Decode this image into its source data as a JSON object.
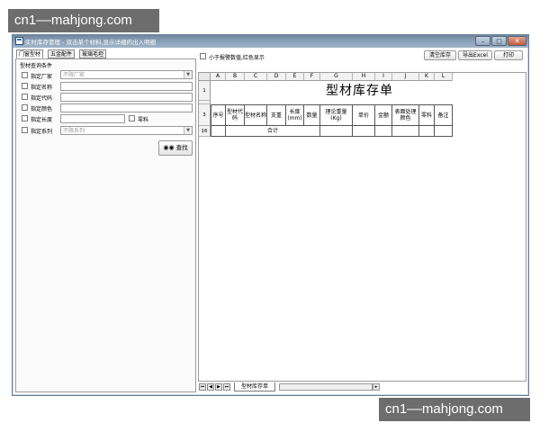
{
  "watermark_top": "cn1––mahjong.com",
  "watermark_bottom": "cn1––mahjong.com",
  "window": {
    "title": "实时库存管理 - 双击某个材料,显示详细的出入明细",
    "min_glyph": "–",
    "max_glyph": "□",
    "close_glyph": "✕"
  },
  "tabs": [
    "门窗型材",
    "五金配件",
    "玻璃毛坦"
  ],
  "query": {
    "group_label": "型材查询条件",
    "manufacturer_label": "指定厂家",
    "manufacturer_placeholder": "不限厂家",
    "name_label": "指定名称",
    "code_label": "指定代码",
    "color_label": "指定颜色",
    "length_label": "指定长度",
    "scrap_label": "零料",
    "series_label": "指定系列",
    "series_placeholder": "不限系列",
    "search_button": "查找"
  },
  "toolbar": {
    "alarm_label": "小于报警数值,红色显示",
    "clear_button": "清空库存",
    "export_button": "导出Excel",
    "print_button": "打印"
  },
  "sheet": {
    "columns": [
      "A",
      "B",
      "C",
      "D",
      "E",
      "F",
      "G",
      "H",
      "I",
      "J",
      "K",
      "L"
    ],
    "row_numbers": [
      "1",
      "2",
      "3",
      "16"
    ],
    "title": "型材库存单",
    "headers": [
      "序号",
      "型材代码",
      "型材名称",
      "支重",
      "长度\n(mm)",
      "数量",
      "理论重量(Kg)",
      "单价",
      "金额",
      "表面处理颜色",
      "零料",
      "备注"
    ],
    "total_label": "合计",
    "sheet_tab": "型材库存单",
    "nav": [
      "⏮",
      "◀",
      "▶",
      "⏭"
    ]
  }
}
